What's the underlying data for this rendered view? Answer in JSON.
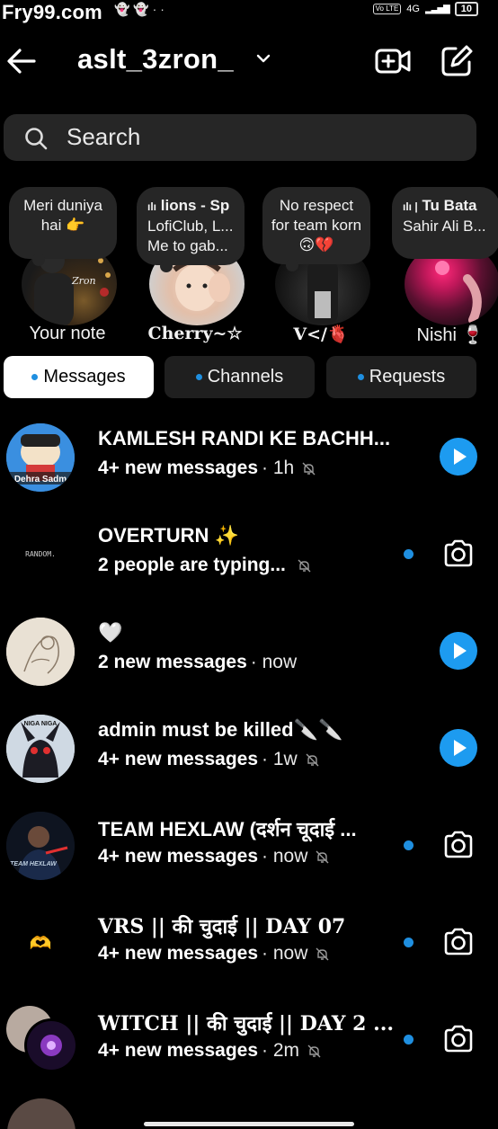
{
  "status_bar": {
    "watermark": "Fry99.com",
    "volte": "Vo LTE",
    "network": "4G",
    "battery": "10"
  },
  "header": {
    "username": "aslt_3zron_"
  },
  "search": {
    "placeholder": "Search"
  },
  "notes": [
    {
      "note_text": "Meri duniya hai 👉",
      "label": "Your note"
    },
    {
      "music_line1": "lions - Sp",
      "music_line2": "LofiClub, L...",
      "note_text": "Me to gab...",
      "label": "𝐂𝐡𝐞𝐫𝐫𝐲~☆"
    },
    {
      "note_text": "No respect for team korn🙃💔",
      "label": "V</🫀"
    },
    {
      "music_line1": "Tu Bata",
      "music_line2": "Sahir Ali B...",
      "label": "Nishi 🍷"
    }
  ],
  "tabs": [
    {
      "label": "Messages",
      "active": true
    },
    {
      "label": "Channels",
      "active": false
    },
    {
      "label": "Requests",
      "active": false
    }
  ],
  "conversations": [
    {
      "name": "KAMLESH RANDI KE BACHH...",
      "preview": "4+ new messages",
      "time": "· 1h",
      "muted": true,
      "unread_dot": false,
      "action": "play-icon",
      "avatar_text": "Dehra Sadm"
    },
    {
      "name": "OVERTURN ✨",
      "preview": "2 people are typing...",
      "time": "",
      "muted": true,
      "unread_dot": true,
      "action": "camera-icon",
      "avatar_text": "RANDOM."
    },
    {
      "name": "🤍",
      "preview": "2 new messages",
      "time": "· now",
      "muted": false,
      "unread_dot": false,
      "action": "play-icon",
      "avatar_text": ""
    },
    {
      "name": "admin must be killed🔪🔪",
      "preview": "4+ new messages",
      "time": "· 1w",
      "muted": true,
      "unread_dot": false,
      "action": "play-icon",
      "avatar_text": "NIGA NIGA"
    },
    {
      "name": "TEAM HEXLAW  (दर्शन चूदाई ...",
      "preview": "4+ new messages",
      "time": "· now",
      "muted": true,
      "unread_dot": true,
      "action": "camera-icon",
      "avatar_text": "TEAM HEXLAW"
    },
    {
      "name": "VRS || की चुदाई || DAY 07",
      "preview": "4+ new messages",
      "time": "· now",
      "muted": true,
      "unread_dot": true,
      "action": "camera-icon",
      "avatar_text": "🫶"
    },
    {
      "name": "WITCH || की चुदाई || DAY 2 ...",
      "preview": "4+ new messages",
      "time": "· 2m",
      "muted": true,
      "unread_dot": true,
      "action": "camera-icon",
      "avatar_text": ""
    }
  ],
  "colors": {
    "background": "#000000",
    "surface": "#262626",
    "accent_blue": "#1d9bf0",
    "unread_dot": "#1f8fe0"
  }
}
